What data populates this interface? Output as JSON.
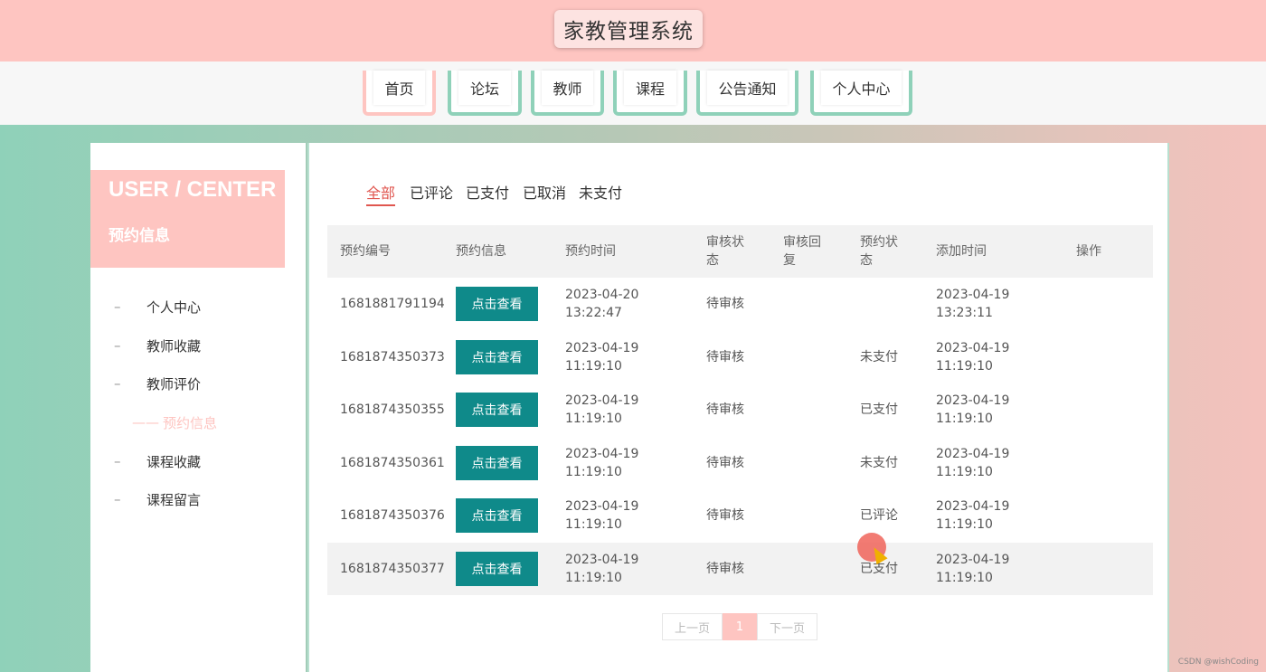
{
  "header": {
    "title": "家教管理系统"
  },
  "nav": [
    {
      "label": "首页",
      "active": true
    },
    {
      "label": "论坛"
    },
    {
      "label": "教师"
    },
    {
      "label": "课程"
    },
    {
      "label": "公告通知"
    },
    {
      "label": "个人中心"
    }
  ],
  "sidebar": {
    "title_en": "USER / CENTER",
    "title_cn": "预约信息",
    "items": [
      {
        "label": "个人中心"
      },
      {
        "label": "教师收藏"
      },
      {
        "label": "教师评价"
      },
      {
        "label": "预约信息",
        "active": true
      },
      {
        "label": "课程收藏"
      },
      {
        "label": "课程留言"
      }
    ]
  },
  "filters": [
    "全部",
    "已评论",
    "已支付",
    "已取消",
    "未支付"
  ],
  "table": {
    "headers": [
      "预约编号",
      "预约信息",
      "预约时间",
      "审核状态",
      "审核回复",
      "预约状态",
      "添加时间",
      "操作"
    ],
    "view_label": "点击查看",
    "rows": [
      {
        "id": "1681881791194",
        "time_date": "2023-04-20",
        "time_clock": "13:22:47",
        "review": "待审核",
        "reply": "",
        "status": "",
        "added_date": "2023-04-19",
        "added_clock": "13:23:11"
      },
      {
        "id": "1681874350373",
        "time_date": "2023-04-19",
        "time_clock": "11:19:10",
        "review": "待审核",
        "reply": "",
        "status": "未支付",
        "added_date": "2023-04-19",
        "added_clock": "11:19:10"
      },
      {
        "id": "1681874350355",
        "time_date": "2023-04-19",
        "time_clock": "11:19:10",
        "review": "待审核",
        "reply": "",
        "status": "已支付",
        "added_date": "2023-04-19",
        "added_clock": "11:19:10"
      },
      {
        "id": "1681874350361",
        "time_date": "2023-04-19",
        "time_clock": "11:19:10",
        "review": "待审核",
        "reply": "",
        "status": "未支付",
        "added_date": "2023-04-19",
        "added_clock": "11:19:10"
      },
      {
        "id": "1681874350376",
        "time_date": "2023-04-19",
        "time_clock": "11:19:10",
        "review": "待审核",
        "reply": "",
        "status": "已评论",
        "added_date": "2023-04-19",
        "added_clock": "11:19:10"
      },
      {
        "id": "1681874350377",
        "time_date": "2023-04-19",
        "time_clock": "11:19:10",
        "review": "待审核",
        "reply": "",
        "status": "已支付",
        "added_date": "2023-04-19",
        "added_clock": "11:19:10"
      }
    ]
  },
  "pager": {
    "prev": "上一页",
    "current": "1",
    "next": "下一页"
  },
  "watermark": "CSDN @wishCoding",
  "colors": {
    "pink": "#fec5c1",
    "mint": "#8fd1b9",
    "teal_button": "#0f8a8a",
    "active_tab": "#e0564f"
  }
}
